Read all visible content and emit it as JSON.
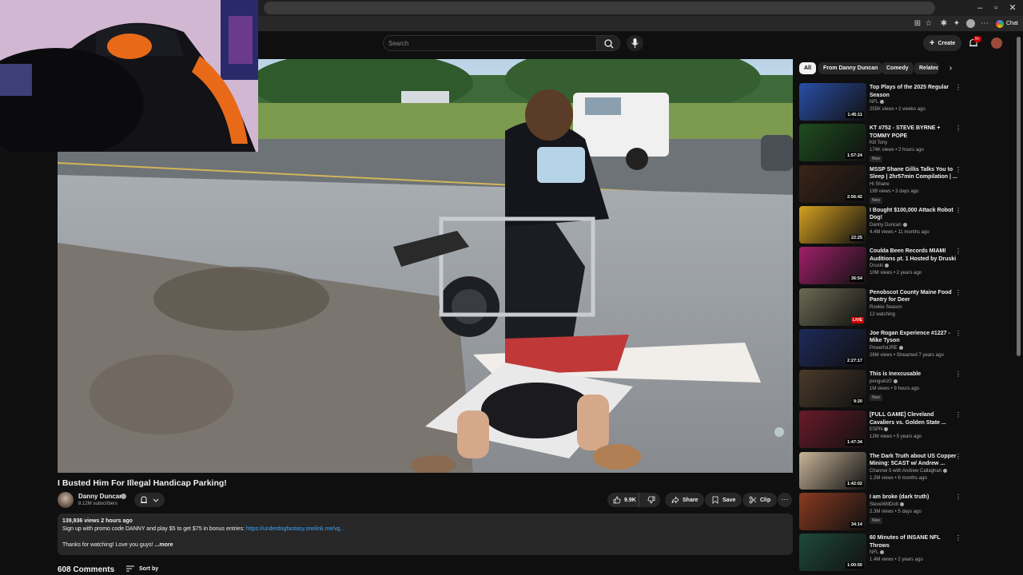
{
  "browser": {
    "chat_label": "Chat"
  },
  "header": {
    "search_placeholder": "Search",
    "create_label": "Create",
    "notification_count": "9+"
  },
  "video": {
    "title": "I Busted Him For Illegal Handicap Parking!",
    "channel": "Danny Duncan",
    "subscribers": "8.12M subscribers",
    "like_count": "9.9K",
    "share_label": "Share",
    "save_label": "Save",
    "clip_label": "Clip",
    "more_glyph": "⋯",
    "views_date": "139,936 views  2 hours ago",
    "desc_text": "Sign up with promo code DANNY and play $5 to get $75 in bonus entries: ",
    "desc_link": "https://underdogfantasy.onelink.me/vg...",
    "desc_text2": "Thanks for watching! Love you guys! ",
    "more_label": "...more"
  },
  "comments": {
    "count": "608 Comments",
    "sort_label": "Sort by"
  },
  "chips": [
    {
      "label": "All",
      "active": true
    },
    {
      "label": "From Danny Duncan",
      "active": false
    },
    {
      "label": "Comedy",
      "active": false
    },
    {
      "label": "Related",
      "active": false
    }
  ],
  "recommendations": [
    {
      "title": "Top Plays of the 2025 Regular Season",
      "channel": "NFL",
      "verified": true,
      "meta": "255K views • 2 weeks ago",
      "duration": "1:45:11",
      "new": false,
      "thumb": "#2a4fa8"
    },
    {
      "title": "KT #752 - STEVE BYRNE + TOMMY POPE",
      "channel": "Kill Tony",
      "verified": false,
      "meta": "174K views • 2 hours ago",
      "duration": "1:57:24",
      "new": true,
      "thumb": "#1e4d1e"
    },
    {
      "title": "MSSP Shane Gillis Talks You to Sleep | 2hr57min Compilation | ...",
      "channel": "Hi Shane",
      "verified": false,
      "meta": "199 views • 3 days ago",
      "duration": "2:56:42",
      "new": true,
      "thumb": "#3a2418"
    },
    {
      "title": "I Bought $100,000 Attack Robot Dog!",
      "channel": "Danny Duncan",
      "verified": true,
      "meta": "4.4M views • 11 months ago",
      "duration": "22:25",
      "new": false,
      "thumb": "#d4a020"
    },
    {
      "title": "Coulda Been Records MIAMI Auditions pt. 1 Hosted by Druski",
      "channel": "Druski",
      "verified": true,
      "meta": "10M views • 2 years ago",
      "duration": "36:54",
      "new": false,
      "thumb": "#a0206a"
    },
    {
      "title": "Penobscot County Maine Food Pantry for Deer",
      "channel": "Rookie Season",
      "verified": false,
      "meta": "12 watching",
      "duration": "LIVE",
      "live": true,
      "new": false,
      "thumb": "#6b6b55"
    },
    {
      "title": "Joe Rogan Experience #1227 - Mike Tyson",
      "channel": "PowerfulJRE",
      "verified": true,
      "meta": "26M views • Streamed 7 years ago",
      "duration": "2:27:17",
      "new": false,
      "thumb": "#1c2a5a"
    },
    {
      "title": "This is Inexcusable",
      "channel": "penguinz0",
      "verified": true,
      "meta": "1M views • 9 hours ago",
      "duration": "9:20",
      "new": true,
      "thumb": "#4a3a2a"
    },
    {
      "title": "[FULL GAME] Cleveland Cavaliers vs. Golden State ...",
      "channel": "ESPN",
      "verified": true,
      "meta": "12M views • 5 years ago",
      "duration": "1:47:34",
      "new": false,
      "thumb": "#6a1a2a"
    },
    {
      "title": "The Dark Truth about US Copper Mining: 5CAST w/ Andrew ...",
      "channel": "Channel 5 with Andrew Callaghan",
      "verified": true,
      "meta": "1.2M views • 6 months ago",
      "duration": "1:42:02",
      "new": false,
      "thumb": "#c8b49a"
    },
    {
      "title": "I am broke (dark truth)",
      "channel": "SteveWillDoIt",
      "verified": true,
      "meta": "2.3M views • 5 days ago",
      "duration": "34:14",
      "new": true,
      "thumb": "#8a3a20"
    },
    {
      "title": "60 Minutes of INSANE NFL Throws",
      "channel": "NFL",
      "verified": true,
      "meta": "1.4M views • 2 years ago",
      "duration": "1:00:50",
      "new": false,
      "thumb": "#1f4a3a"
    }
  ]
}
